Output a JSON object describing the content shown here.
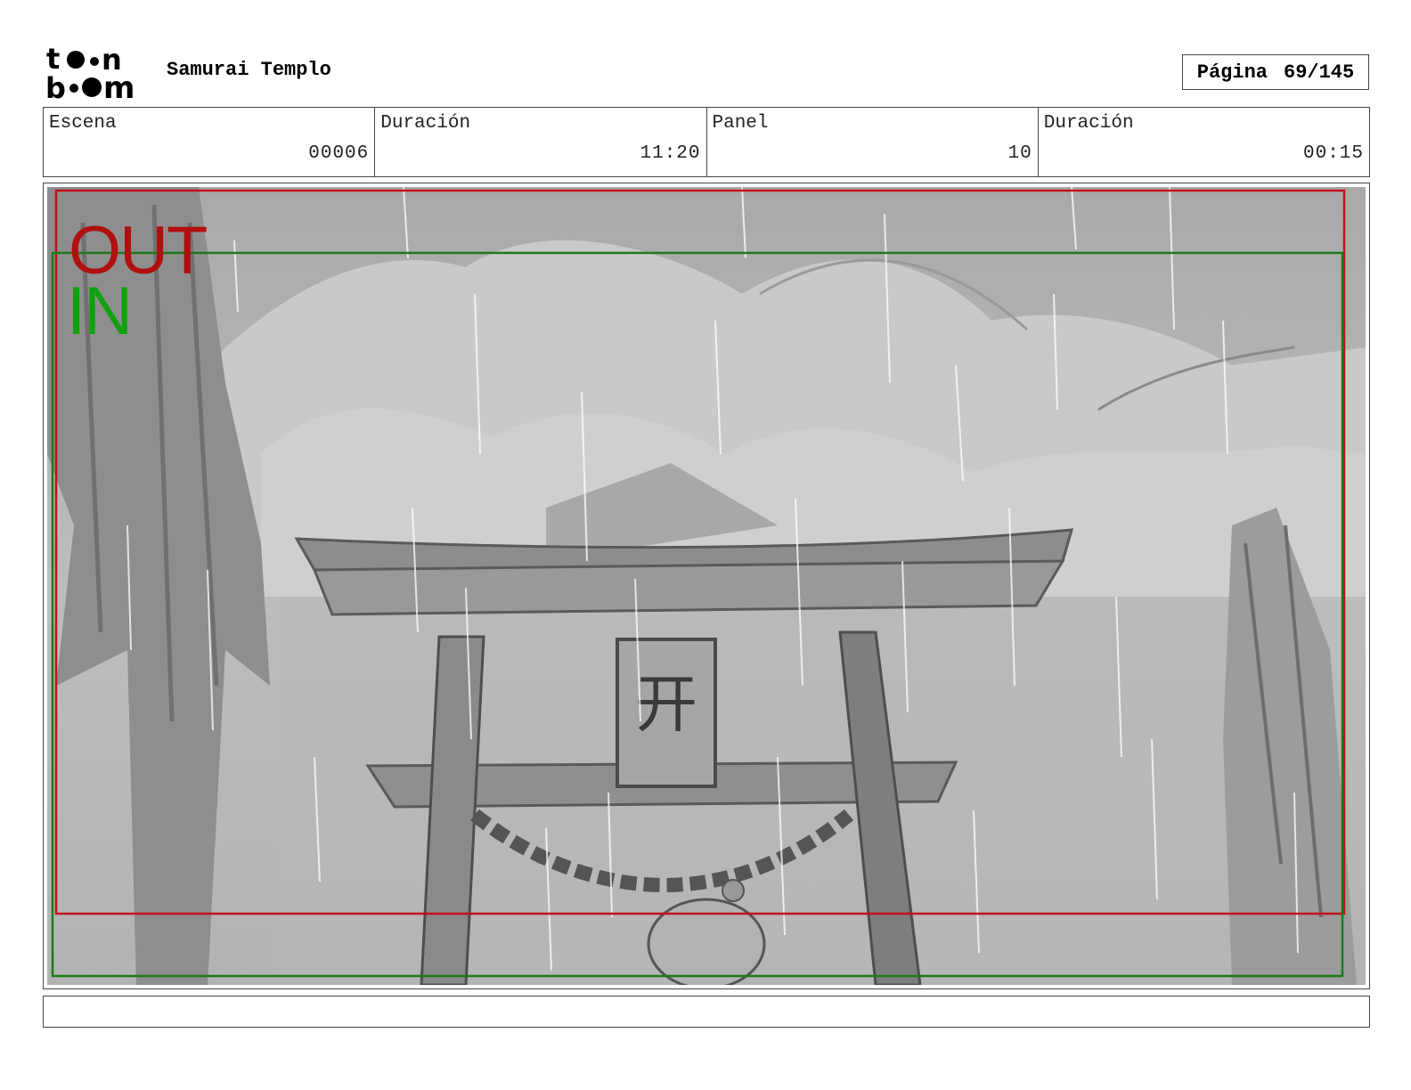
{
  "header": {
    "logo_icon": "toonboom-logo",
    "logo_text": "toon boom",
    "project_title": "Samurai Templo",
    "page_label": "Página",
    "page_value": "69/145"
  },
  "info": {
    "cells": [
      {
        "label": "Escena",
        "value": "00006"
      },
      {
        "label": "Duración",
        "value": "11:20"
      },
      {
        "label": "Panel",
        "value": "10"
      },
      {
        "label": "Duración",
        "value": "00:15"
      }
    ]
  },
  "panel": {
    "out_label": "OUT",
    "in_label": "IN",
    "out_color": "#b01010",
    "in_color": "#10a010",
    "out_frame_color": "#c0101a",
    "in_frame_color": "#1a7a1a",
    "sign_kanji": "开"
  },
  "dialogue": {
    "text": ""
  }
}
